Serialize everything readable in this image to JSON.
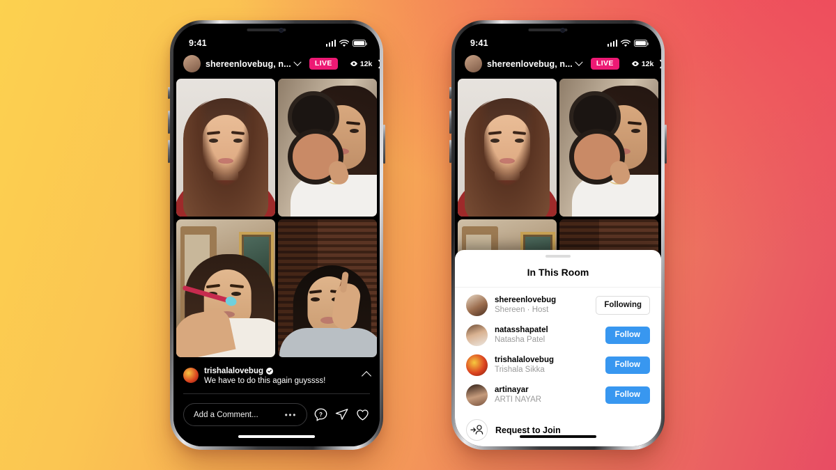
{
  "background": {
    "gradient_from": "#fcd14f",
    "gradient_mid": "#f0845d",
    "gradient_to": "#e84c63"
  },
  "status_bar": {
    "time": "9:41",
    "cellular_icon": "signal-bars-icon",
    "wifi_icon": "wifi-icon",
    "battery_icon": "battery-full-icon"
  },
  "live_header": {
    "avatar_icon": "host-avatar",
    "title": "shereenlovebug, n...",
    "chevron_icon": "chevron-down-icon",
    "live_badge": "LIVE",
    "live_badge_color": "#ed1a74",
    "viewer_icon": "eye-icon",
    "viewer_count": "12k",
    "close_icon": "close-icon"
  },
  "grid": {
    "tiles": [
      {
        "name": "participant-tile-1",
        "label": "woman in red top"
      },
      {
        "name": "participant-tile-2",
        "label": "woman holding compact"
      },
      {
        "name": "participant-tile-3",
        "label": "woman applying eyeshadow"
      },
      {
        "name": "participant-tile-4",
        "label": "woman in front of shutters"
      }
    ]
  },
  "caption": {
    "avatar_icon": "commenter-avatar",
    "username": "trishalalovebug",
    "verified_icon": "verified-badge-icon",
    "message": "We have to do this again guyssss!",
    "collapse_icon": "chevron-up-icon"
  },
  "comment_bar": {
    "placeholder": "Add a Comment...",
    "more_icon": "ellipsis-icon",
    "question_icon": "question-bubble-icon",
    "send_icon": "paper-plane-icon",
    "like_icon": "heart-icon"
  },
  "sheet": {
    "grabber_icon": "drag-handle-icon",
    "title": "In This Room",
    "people": [
      {
        "username": "shereenlovebug",
        "subtitle": "Shereen · Host",
        "action": "Following",
        "action_style": "outline",
        "avatar": "avatar-shereen"
      },
      {
        "username": "natasshapatel",
        "subtitle": "Natasha Patel",
        "action": "Follow",
        "action_style": "filled",
        "avatar": "avatar-natassha"
      },
      {
        "username": "trishalalovebug",
        "subtitle": "Trishala Sikka",
        "action": "Follow",
        "action_style": "filled",
        "avatar": "avatar-trishala"
      },
      {
        "username": "artinayar",
        "subtitle": "ARTI NAYAR",
        "action": "Follow",
        "action_style": "filled",
        "avatar": "avatar-arti"
      }
    ],
    "request": {
      "icon": "add-person-icon",
      "label": "Request to Join"
    },
    "follow_color": "#3897f0"
  }
}
